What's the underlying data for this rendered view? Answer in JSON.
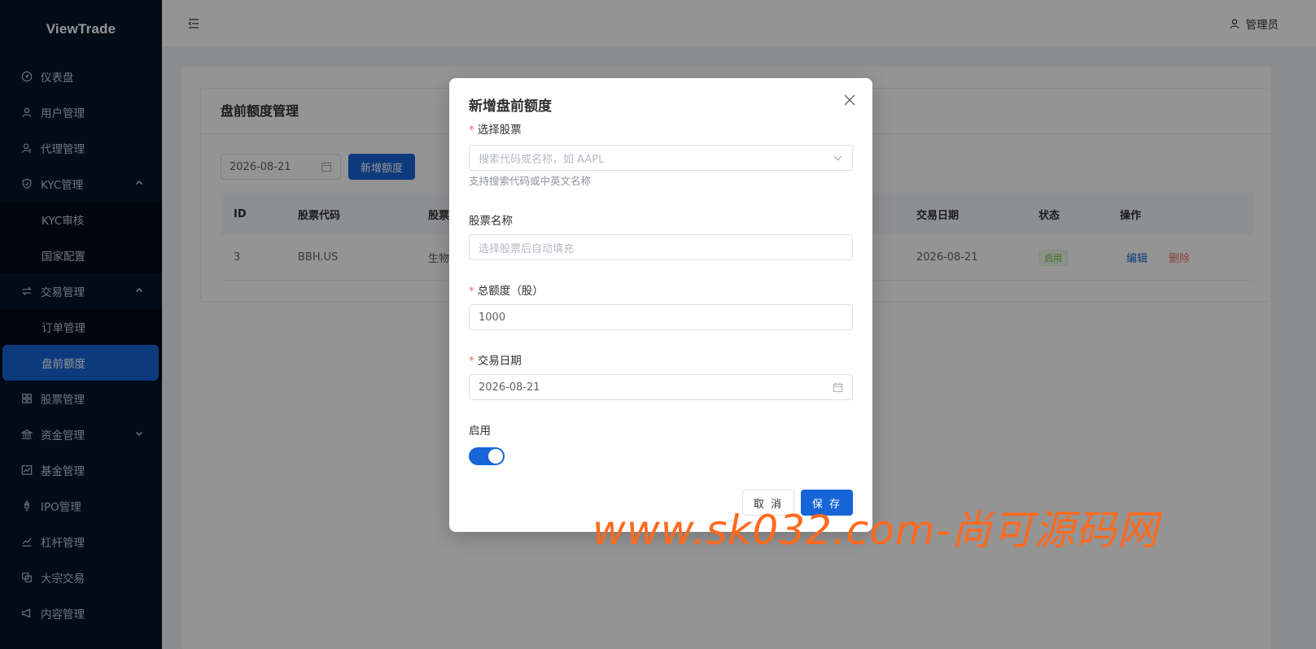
{
  "sidebar": {
    "logo": "ViewTrade",
    "items": [
      {
        "label": "仪表盘"
      },
      {
        "label": "用户管理"
      },
      {
        "label": "代理管理"
      },
      {
        "label": "KYC管理"
      },
      {
        "label": "KYC审核"
      },
      {
        "label": "国家配置"
      },
      {
        "label": "交易管理"
      },
      {
        "label": "订单管理"
      },
      {
        "label": "盘前额度"
      },
      {
        "label": "股票管理"
      },
      {
        "label": "资金管理"
      },
      {
        "label": "基金管理"
      },
      {
        "label": "IPO管理"
      },
      {
        "label": "杠杆管理"
      },
      {
        "label": "大宗交易"
      },
      {
        "label": "内容管理"
      }
    ],
    "active": "盘前额度"
  },
  "header": {
    "user": "管理员"
  },
  "page": {
    "title": "盘前额度管理",
    "date_filter": "2026-08-21",
    "add_button": "新增额度"
  },
  "table": {
    "columns": [
      "ID",
      "股票代码",
      "股票",
      "交易日期",
      "状态",
      "操作"
    ],
    "rows": [
      {
        "id": "3",
        "code": "BBH.US",
        "name": "生物",
        "date": "2026-08-21",
        "status": "启用",
        "edit": "编辑",
        "delete": "删除"
      }
    ]
  },
  "dialog": {
    "title": "新增盘前额度",
    "stock_label": "选择股票",
    "stock_placeholder": "搜索代码或名称，如 AAPL",
    "stock_hint": "支持搜索代码或中英文名称",
    "name_label": "股票名称",
    "name_placeholder": "选择股票后自动填充",
    "quota_label": "总额度（股）",
    "quota_value": "1000",
    "date_label": "交易日期",
    "date_value": "2026-08-21",
    "enable_label": "启用",
    "enabled": true,
    "cancel": "取 消",
    "save": "保 存"
  },
  "watermark": "www.sk032.com-尚可源码网",
  "colors": {
    "sidebar_bg": "#001529",
    "primary": "#1765d6",
    "danger": "#f56c6c",
    "success": "#67c23a",
    "watermark": "#ff6a1f"
  }
}
